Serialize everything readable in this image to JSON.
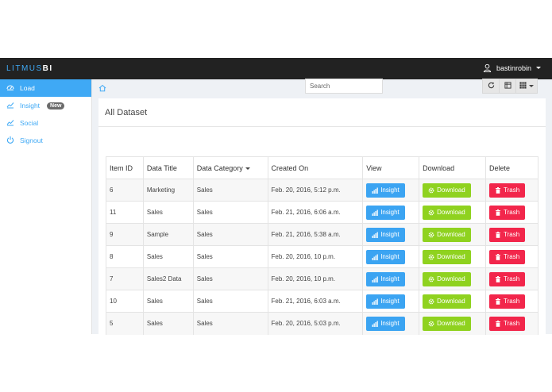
{
  "topbar": {
    "brand_prefix": "LITMUS",
    "brand_suffix": "BI",
    "username": "bastinrobin"
  },
  "sidebar": {
    "items": [
      {
        "label": "Load",
        "icon": "dashboard-icon",
        "active": true
      },
      {
        "label": "Insight",
        "icon": "chart-icon",
        "badge": "New"
      },
      {
        "label": "Social",
        "icon": "chart-icon"
      },
      {
        "label": "Signout",
        "icon": "power-icon"
      }
    ]
  },
  "main": {
    "title": "All Dataset",
    "search": {
      "placeholder": "Search"
    },
    "table": {
      "headers": [
        "Item ID",
        "Data Title",
        "Data Category",
        "Created On",
        "View",
        "Download",
        "Delete"
      ],
      "actions": {
        "insight": "Insight",
        "download": "Download",
        "trash": "Trash"
      },
      "rows": [
        {
          "id": "6",
          "title": "Marketing",
          "category": "Sales",
          "created": "Feb. 20, 2016, 5:12 p.m."
        },
        {
          "id": "11",
          "title": "Sales",
          "category": "Sales",
          "created": "Feb. 21, 2016, 6:06 a.m."
        },
        {
          "id": "9",
          "title": "Sample",
          "category": "Sales",
          "created": "Feb. 21, 2016, 5:38 a.m."
        },
        {
          "id": "8",
          "title": "Sales",
          "category": "Sales",
          "created": "Feb. 20, 2016, 10 p.m."
        },
        {
          "id": "7",
          "title": "Sales2 Data",
          "category": "Sales",
          "created": "Feb. 20, 2016, 10 p.m."
        },
        {
          "id": "10",
          "title": "Sales",
          "category": "Sales",
          "created": "Feb. 21, 2016, 6:03 a.m."
        },
        {
          "id": "5",
          "title": "Sales",
          "category": "Sales",
          "created": "Feb. 20, 2016, 5:03 p.m."
        }
      ]
    }
  },
  "colors": {
    "accent": "#3fa9f5",
    "insight": "#3ba4f2",
    "download": "#8fd21f",
    "trash": "#f2264b",
    "topbar": "#222222"
  }
}
